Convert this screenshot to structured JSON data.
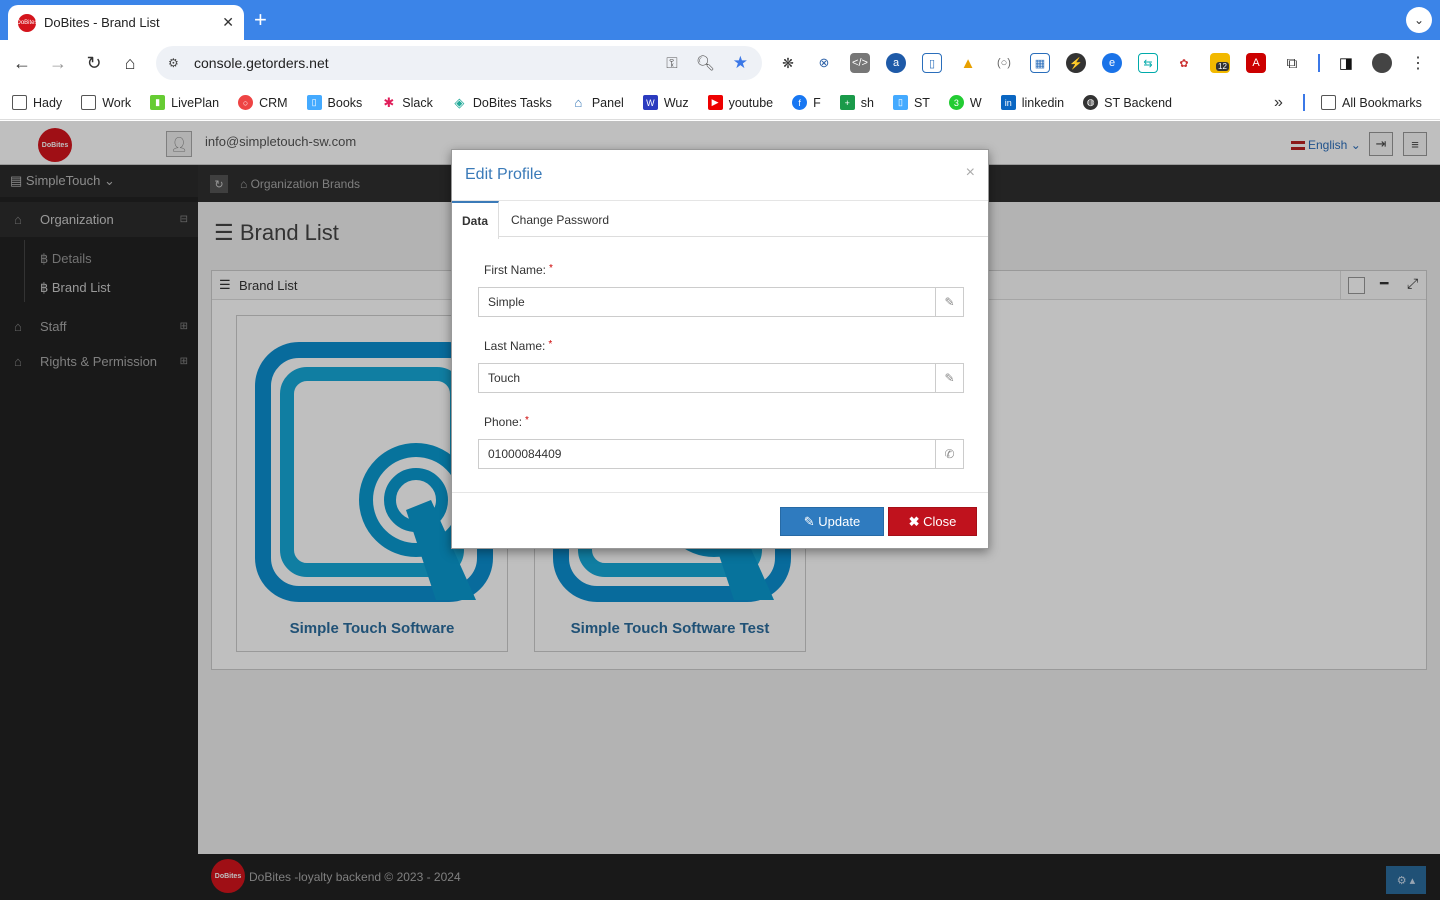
{
  "browser": {
    "tab_title": "DoBites - Brand List",
    "tab_favicon": "DoBites",
    "new_tab": "+",
    "url": "console.getorders.net",
    "bookmarks": [
      {
        "label": "Hady",
        "icon": "folder-icon"
      },
      {
        "label": "Work",
        "icon": "folder-icon"
      },
      {
        "label": "LivePlan",
        "icon": "liveplan-icon"
      },
      {
        "label": "CRM",
        "icon": "crm-icon"
      },
      {
        "label": "Books",
        "icon": "books-icon"
      },
      {
        "label": "Slack",
        "icon": "slack-icon"
      },
      {
        "label": "DoBites Tasks",
        "icon": "tasks-icon"
      },
      {
        "label": "Panel",
        "icon": "panel-icon"
      },
      {
        "label": "Wuz",
        "icon": "wuz-icon"
      },
      {
        "label": "youtube",
        "icon": "youtube-icon"
      },
      {
        "label": "F",
        "icon": "facebook-icon"
      },
      {
        "label": "sh",
        "icon": "sheets-icon"
      },
      {
        "label": "ST",
        "icon": "st-icon"
      },
      {
        "label": "W",
        "icon": "whatsapp-icon"
      },
      {
        "label": "linkedin",
        "icon": "linkedin-icon"
      },
      {
        "label": "ST Backend",
        "icon": "globe-icon"
      }
    ],
    "more_bookmarks": "»",
    "all_bookmarks": "All Bookmarks",
    "ext_badge": "12"
  },
  "header": {
    "logo": "DoBites",
    "email": "info@simpletouch-sw.com",
    "language": "English"
  },
  "sidebar": {
    "org_selector": "SimpleTouch",
    "items": [
      {
        "label": "Organization",
        "expanded": true
      },
      {
        "label": "Staff",
        "expanded": false
      },
      {
        "label": "Rights & Permission",
        "expanded": false
      }
    ],
    "subitems": [
      "Details",
      "Brand List"
    ]
  },
  "breadcrumb": "Organization Brands",
  "page": {
    "title": "Brand List",
    "panel_title": "Brand List",
    "brands": [
      {
        "name": "Simple Touch Software"
      },
      {
        "name": "Simple Touch Software Test"
      }
    ]
  },
  "footer": {
    "logo": "DoBites",
    "text": "DoBites -loyalty backend © 2023 - 2024"
  },
  "modal": {
    "title": "Edit Profile",
    "close_symbol": "×",
    "tabs": [
      "Data",
      "Change Password"
    ],
    "active_tab": "Data",
    "fields": {
      "first_name_label": "First Name:",
      "first_name_value": "Simple",
      "last_name_label": "Last Name:",
      "last_name_value": "Touch",
      "phone_label": "Phone:",
      "phone_value": "01000084409",
      "required_mark": "*"
    },
    "update_label": "Update",
    "close_label": "Close"
  },
  "colors": {
    "chrome_blue": "#3b84e8",
    "brand_red": "#d4141c",
    "primary": "#2f7bbf",
    "danger": "#c0121d"
  }
}
